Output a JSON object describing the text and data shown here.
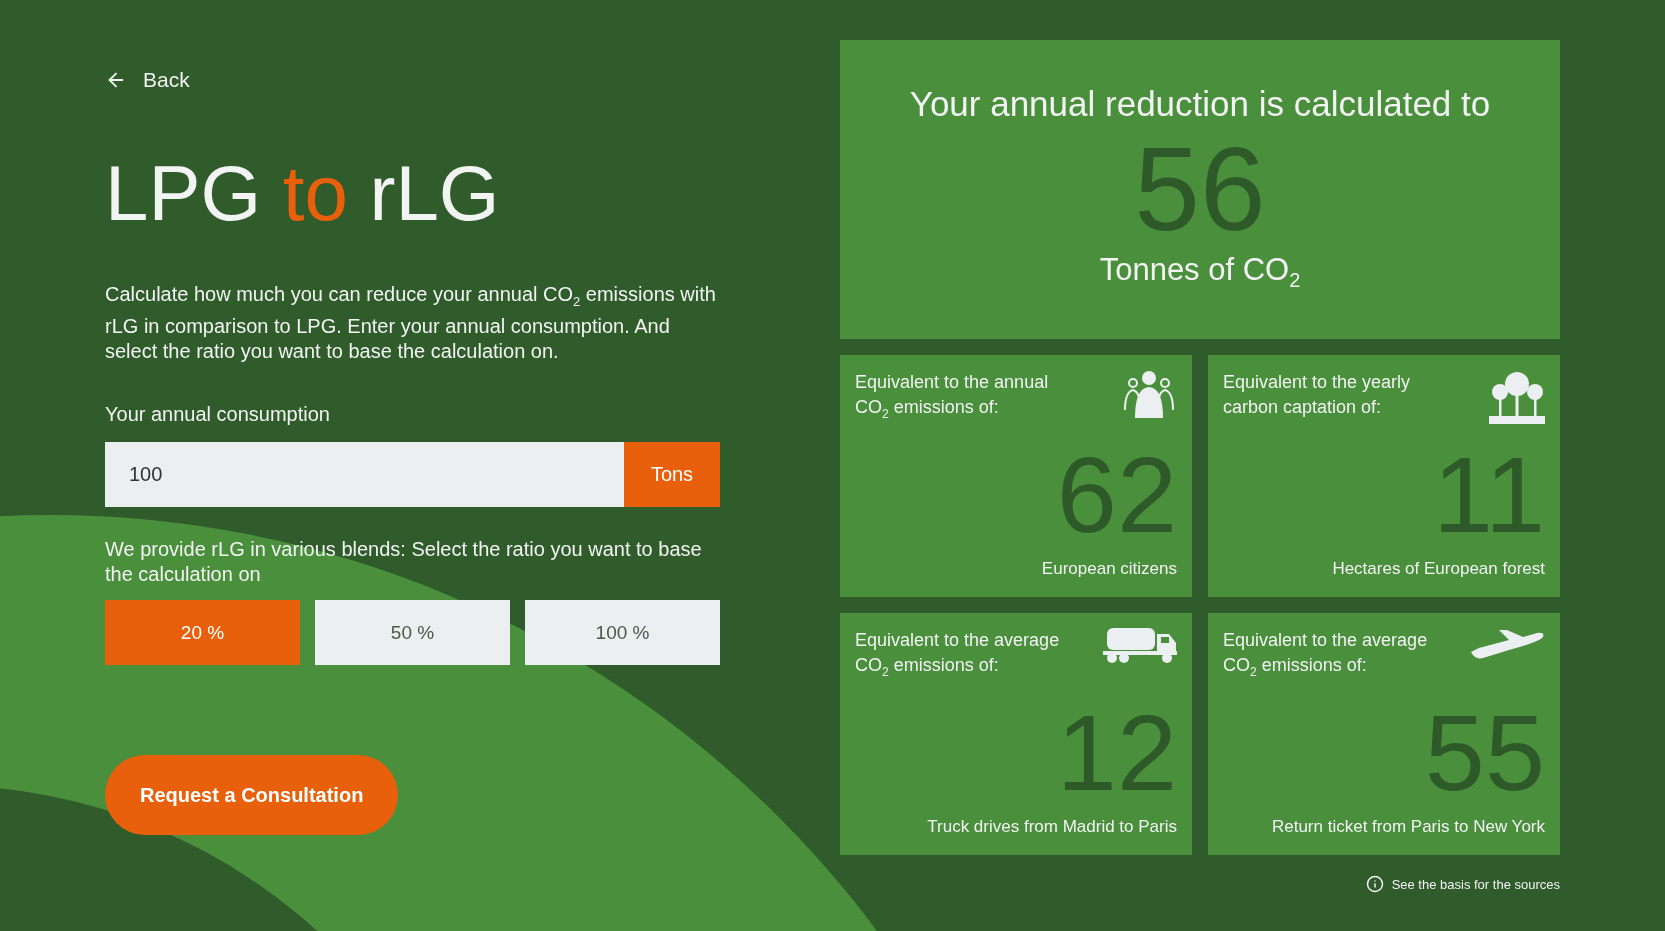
{
  "back": {
    "label": "Back"
  },
  "title_parts": [
    {
      "text": "LPG ",
      "accent": false
    },
    {
      "text": "to",
      "accent": true
    },
    {
      "text": " rLG",
      "accent": false
    }
  ],
  "description": "Calculate how much you can reduce your annual CO$_{2}$ emissions with rLG in comparison to LPG. Enter your annual consumption. And select the ratio you want to base the calculation on.",
  "consumption": {
    "label": "Your annual consumption",
    "value": "100",
    "unit": "Tons"
  },
  "blends": {
    "label": "We provide rLG in various blends: Select the ratio you want to base the calculation on",
    "options": [
      {
        "label": "20 %",
        "selected": true
      },
      {
        "label": "50 %",
        "selected": false
      },
      {
        "label": "100 %",
        "selected": false
      }
    ]
  },
  "cta": {
    "label": "Request a Consultation"
  },
  "result": {
    "heading": "Your annual reduction is calculated to",
    "value": "56",
    "unit": "Tonnes of CO$_{2}$"
  },
  "equivalents": [
    {
      "kind": "people",
      "text": "Equivalent to the annual CO$_{2}$ emissions of:",
      "value": "62",
      "caption": "European citizens"
    },
    {
      "kind": "trees",
      "text": "Equivalent to the yearly carbon captation of:",
      "value": "11",
      "caption": "Hectares of European forest"
    },
    {
      "kind": "truck",
      "text": "Equivalent to the average CO$_{2}$ emissions of:",
      "value": "12",
      "caption": "Truck drives from Madrid to Paris"
    },
    {
      "kind": "plane",
      "text": "Equivalent to the average CO$_{2}$ emissions of:",
      "value": "55",
      "caption": "Return ticket from Paris to New York"
    }
  ],
  "footer": {
    "label": "See the basis for the sources"
  }
}
